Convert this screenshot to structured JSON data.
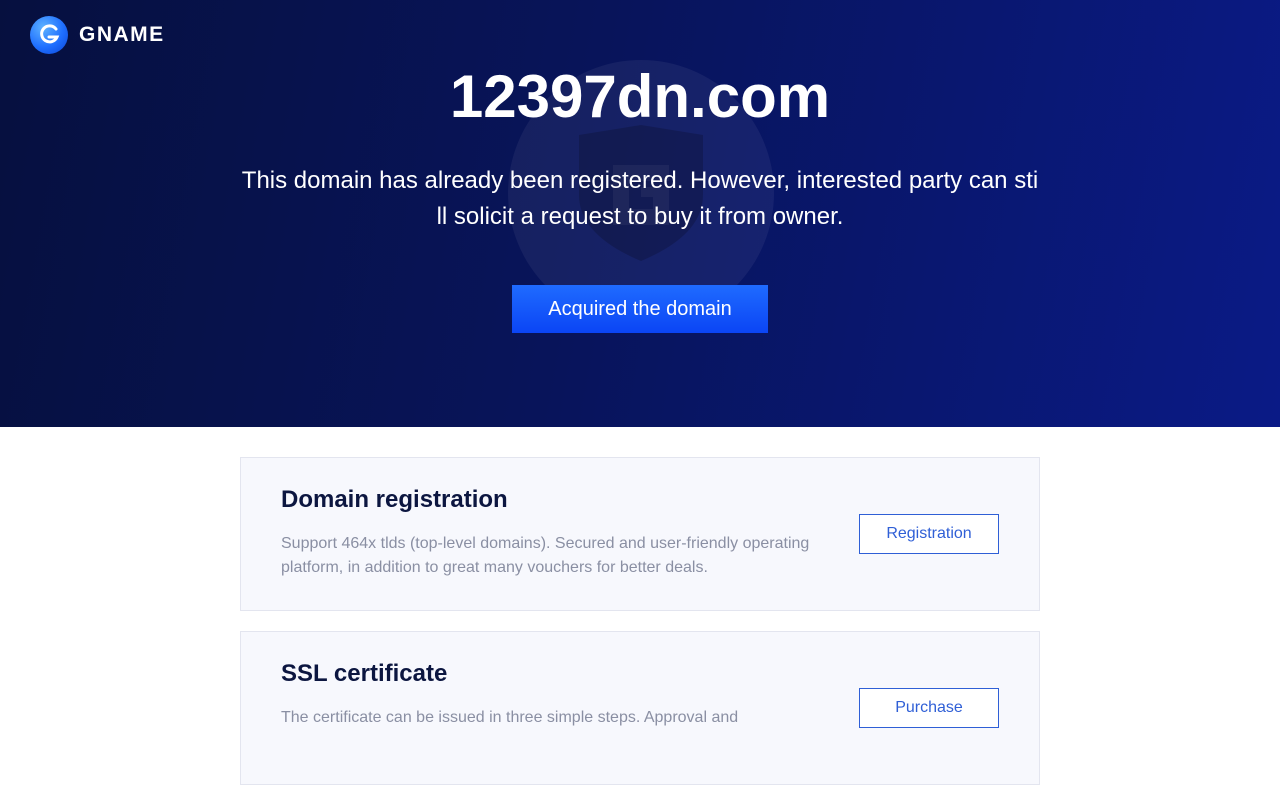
{
  "brand": {
    "name": "GNAME",
    "icon": "gname-logo-icon"
  },
  "hero": {
    "domain": "12397dn.com",
    "description": "This domain has already been registered. However, interested party can still solicit a request to buy it from owner.",
    "cta_label": "Acquired the domain",
    "watermark_icon": "shield-icon"
  },
  "cards": [
    {
      "title": "Domain registration",
      "description": "Support 464x tlds (top-level domains). Secured and user-friendly operating platform, in addition to great many vouchers for better deals.",
      "button_label": "Registration"
    },
    {
      "title": "SSL certificate",
      "description": "The certificate can be issued in three simple steps. Approval and",
      "button_label": "Purchase"
    }
  ],
  "colors": {
    "hero_bg": "#08145a",
    "accent": "#1f6bff",
    "card_bg": "#f7f8fd",
    "button_border": "#2f5fd6",
    "title_text": "#0c1640"
  }
}
